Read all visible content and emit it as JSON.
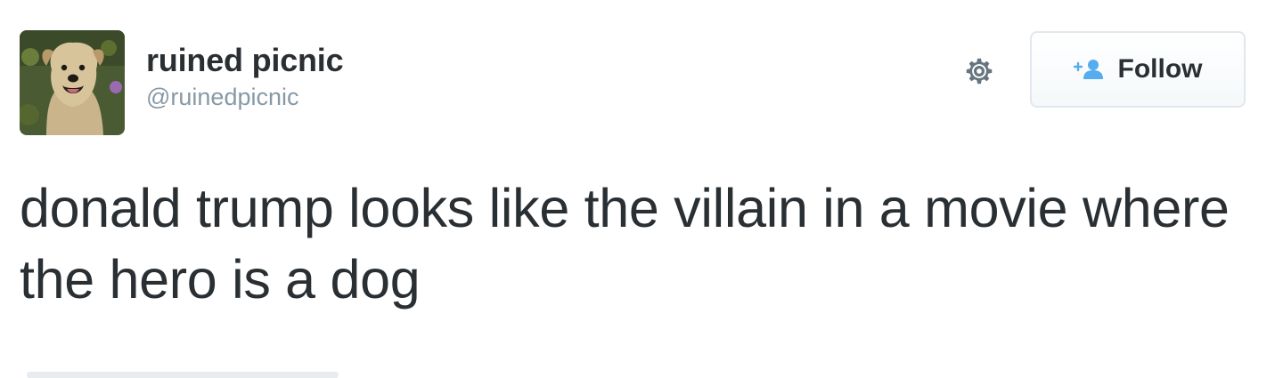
{
  "tweet": {
    "user": {
      "display_name": "ruined picnic",
      "handle": "@ruinedpicnic",
      "avatar_icon": "dog-photo-avatar"
    },
    "actions": {
      "settings_icon": "gear-icon",
      "follow_icon": "add-user-icon",
      "follow_label": "Follow"
    },
    "text": "donald trump looks like the villain in a movie where the hero is a dog"
  },
  "colors": {
    "text": "#292f33",
    "muted": "#8899a6",
    "accent": "#55acee",
    "border": "#e1e8ed"
  }
}
